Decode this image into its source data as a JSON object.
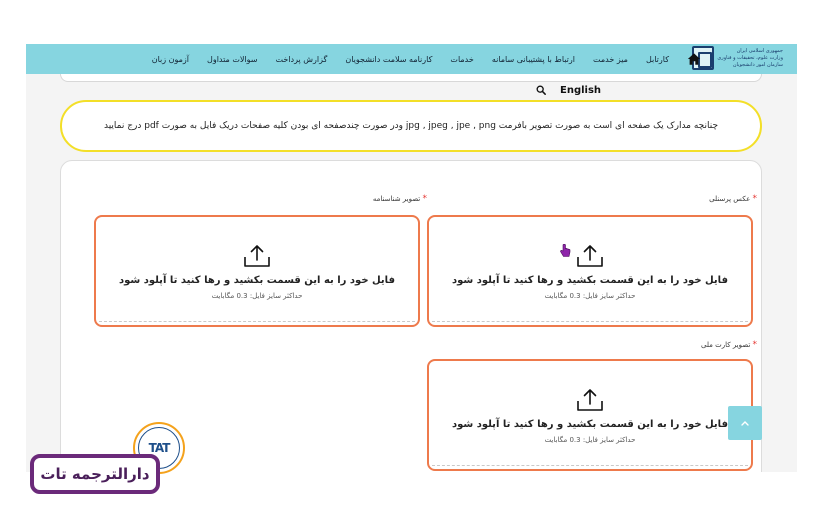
{
  "header": {
    "logo_lines": [
      "جمهوری اسلامی ایران",
      "وزارت علوم، تحقیقات و فناوری",
      "سازمان امور دانشجویان"
    ],
    "home_icon": "home-icon",
    "nav": [
      {
        "label": "کارتابل"
      },
      {
        "label": "میز خدمت"
      },
      {
        "label": "ارتباط با پشتیبانی سامانه"
      },
      {
        "label": "خدمات"
      },
      {
        "label": "کارنامه سلامت دانشجویان"
      },
      {
        "label": "گزارش پرداخت"
      },
      {
        "label": "سوالات متداول"
      },
      {
        "label": "آزمون زبان"
      }
    ]
  },
  "lang_bar": {
    "search_icon": "search-icon",
    "language": "English"
  },
  "notice": {
    "text": "چنانچه مدارک یک صفحه ای است به صورت تصویر بافرمت jpg , jpeg , jpe , png ودر صورت چندصفحه ای بودن کلیه صفحات دریک فایل به صورت pdf درج نمایید"
  },
  "upload_fields": [
    {
      "label": "عکس پرسنلی",
      "required_mark": "*",
      "title": "فایل خود را به این قسمت بکشید و رها کنید تا آپلود شود",
      "size_note": "حداکثر سایز فایل: 0.3 مگابایت"
    },
    {
      "label": "تصویر شناسنامه",
      "required_mark": "*",
      "title": "فایل خود را به این قسمت بکشید و رها کنید تا آپلود شود",
      "size_note": "حداکثر سایز فایل: 0.3 مگابایت"
    },
    {
      "label": "تصویر کارت ملی",
      "required_mark": "*",
      "title": "فایل خود را به این قسمت بکشید و رها کنید تا آپلود شود",
      "size_note": "حداکثر سایز فایل: 0.3 مگابایت"
    }
  ],
  "watermark": {
    "logo_text": "TAT",
    "name": "دارالترجمه تات"
  },
  "colors": {
    "navbar": "#86d5e0",
    "notice_border": "#f3df28",
    "dropzone_border": "#ee7a4c",
    "required": "#e53935",
    "watermark_border": "#6b2a7a"
  }
}
